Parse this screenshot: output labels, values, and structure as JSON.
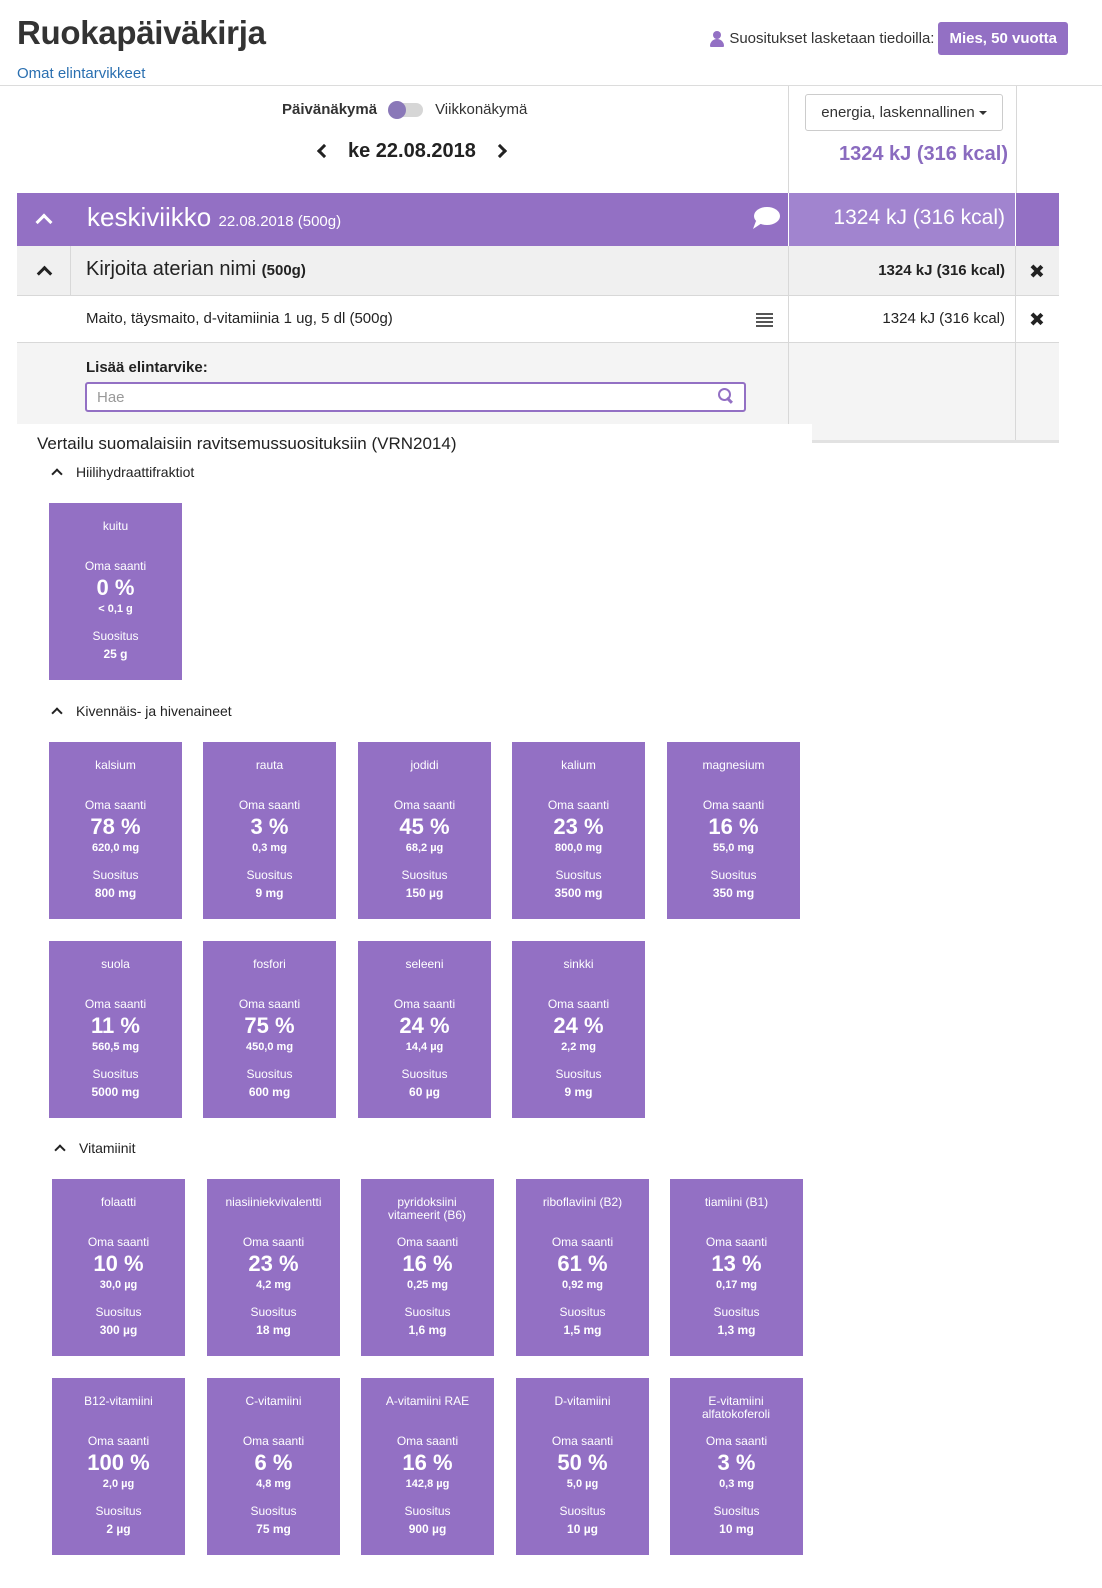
{
  "header": {
    "title": "Ruokapäiväkirja",
    "own_foods_link": "Omat elintarvikkeet",
    "reco_label": "Suositukset lasketaan tiedoilla:",
    "profile_button": "Mies, 50 vuotta"
  },
  "view": {
    "day_label": "Päivänäkymä",
    "week_label": "Viikkonäkymä",
    "date": "ke 22.08.2018"
  },
  "energy": {
    "select_label": "energia, laskennallinen",
    "total": "1324 kJ (316 kcal)"
  },
  "day": {
    "name": "keskiviikko",
    "date_meta": "22.08.2018 (500g)",
    "energy": "1324 kJ (316 kcal)"
  },
  "meal": {
    "name": "Kirjoita aterian nimi",
    "meta": "(500g)",
    "energy": "1324 kJ (316 kcal)"
  },
  "food": {
    "name": "Maito, täysmaito, d-vitamiinia 1 ug, 5 dl (500g)",
    "energy": "1324 kJ (316 kcal)"
  },
  "add_food": {
    "label": "Lisää elintarvike:",
    "placeholder": "Hae"
  },
  "comparison": {
    "title": "Vertailu suomalaisiin ravitsemussuosituksiin (VRN2014)",
    "own_label": "Oma saanti",
    "reco_label": "Suositus",
    "sections": [
      {
        "title": "Hiilihydraattifraktiot",
        "cards": [
          {
            "name": "kuitu",
            "pct": "0 %",
            "amount": "< 0,1 g",
            "reco": "25 g"
          }
        ]
      },
      {
        "title": "Kivennäis- ja hivenaineet",
        "cards": [
          {
            "name": "kalsium",
            "pct": "78 %",
            "amount": "620,0 mg",
            "reco": "800 mg"
          },
          {
            "name": "rauta",
            "pct": "3 %",
            "amount": "0,3 mg",
            "reco": "9 mg"
          },
          {
            "name": "jodidi",
            "pct": "45 %",
            "amount": "68,2 µg",
            "reco": "150 µg"
          },
          {
            "name": "kalium",
            "pct": "23 %",
            "amount": "800,0 mg",
            "reco": "3500 mg"
          },
          {
            "name": "magnesium",
            "pct": "16 %",
            "amount": "55,0 mg",
            "reco": "350 mg"
          },
          {
            "name": "suola",
            "pct": "11 %",
            "amount": "560,5 mg",
            "reco": "5000 mg"
          },
          {
            "name": "fosfori",
            "pct": "75 %",
            "amount": "450,0 mg",
            "reco": "600 mg"
          },
          {
            "name": "seleeni",
            "pct": "24 %",
            "amount": "14,4 µg",
            "reco": "60 µg"
          },
          {
            "name": "sinkki",
            "pct": "24 %",
            "amount": "2,2 mg",
            "reco": "9 mg"
          }
        ]
      },
      {
        "title": "Vitamiinit",
        "cards": [
          {
            "name": "folaatti",
            "pct": "10 %",
            "amount": "30,0 µg",
            "reco": "300 µg"
          },
          {
            "name": "niasiiniekvivalentti",
            "pct": "23 %",
            "amount": "4,2 mg",
            "reco": "18 mg"
          },
          {
            "name": "pyridoksiini vitameerit (B6)",
            "pct": "16 %",
            "amount": "0,25 mg",
            "reco": "1,6 mg"
          },
          {
            "name": "riboflaviini (B2)",
            "pct": "61 %",
            "amount": "0,92 mg",
            "reco": "1,5 mg"
          },
          {
            "name": "tiamiini (B1)",
            "pct": "13 %",
            "amount": "0,17 mg",
            "reco": "1,3 mg"
          },
          {
            "name": "B12-vitamiini",
            "pct": "100 %",
            "amount": "2,0 µg",
            "reco": "2 µg"
          },
          {
            "name": "C-vitamiini",
            "pct": "6 %",
            "amount": "4,8 mg",
            "reco": "75 mg"
          },
          {
            "name": "A-vitamiini RAE",
            "pct": "16 %",
            "amount": "142,8 µg",
            "reco": "900 µg"
          },
          {
            "name": "D-vitamiini",
            "pct": "50 %",
            "amount": "5,0 µg",
            "reco": "10 µg"
          },
          {
            "name": "E-vitamiini alfatokoferoli",
            "pct": "3 %",
            "amount": "0,3 mg",
            "reco": "10 mg"
          }
        ]
      }
    ]
  }
}
